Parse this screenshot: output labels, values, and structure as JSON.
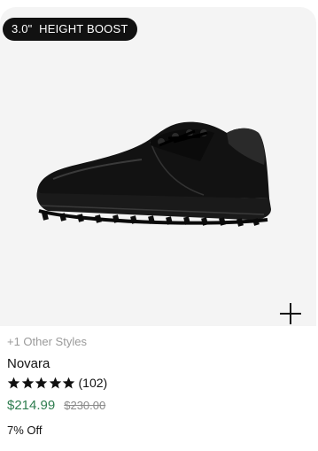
{
  "product": {
    "badge": "3.0\"  HEIGHT BOOST",
    "other_styles": "+1 Other Styles",
    "name": "Novara",
    "rating": 5,
    "review_count": "(102)",
    "price": "$214.99",
    "original_price": "$230.00",
    "discount": "7% Off"
  },
  "colors": {
    "price": "#2e7d4f",
    "image_background": "#f4f4f4",
    "badge_background": "#111111"
  },
  "icons": {
    "add": "plus-icon",
    "star": "star-icon",
    "product": "shoe-image"
  }
}
